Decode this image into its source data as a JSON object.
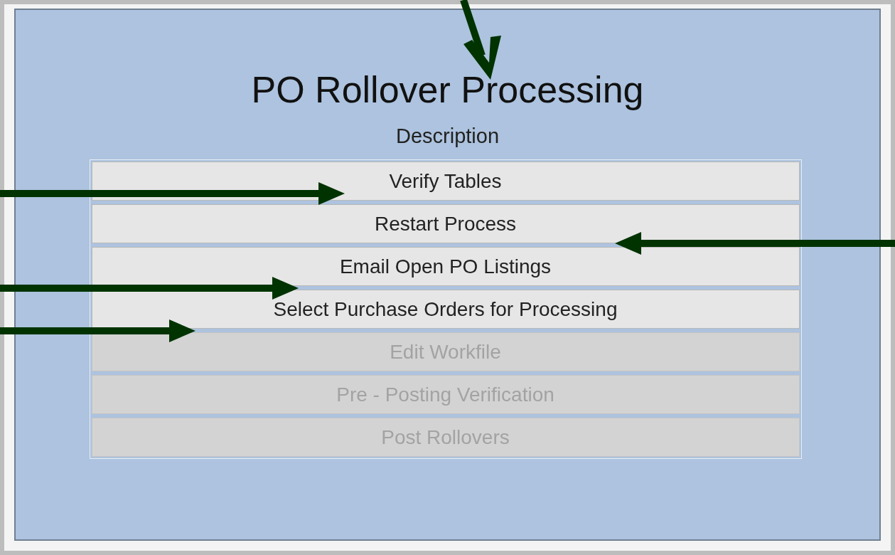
{
  "title": "PO Rollover Processing",
  "subtitle": "Description",
  "buttons": [
    {
      "label": "Verify Tables",
      "disabled": false
    },
    {
      "label": "Restart Process",
      "disabled": false
    },
    {
      "label": "Email Open PO Listings",
      "disabled": false
    },
    {
      "label": "Select Purchase Orders for Processing",
      "disabled": false
    },
    {
      "label": "Edit Workfile",
      "disabled": true
    },
    {
      "label": "Pre - Posting Verification",
      "disabled": true
    },
    {
      "label": "Post Rollovers",
      "disabled": true
    }
  ]
}
